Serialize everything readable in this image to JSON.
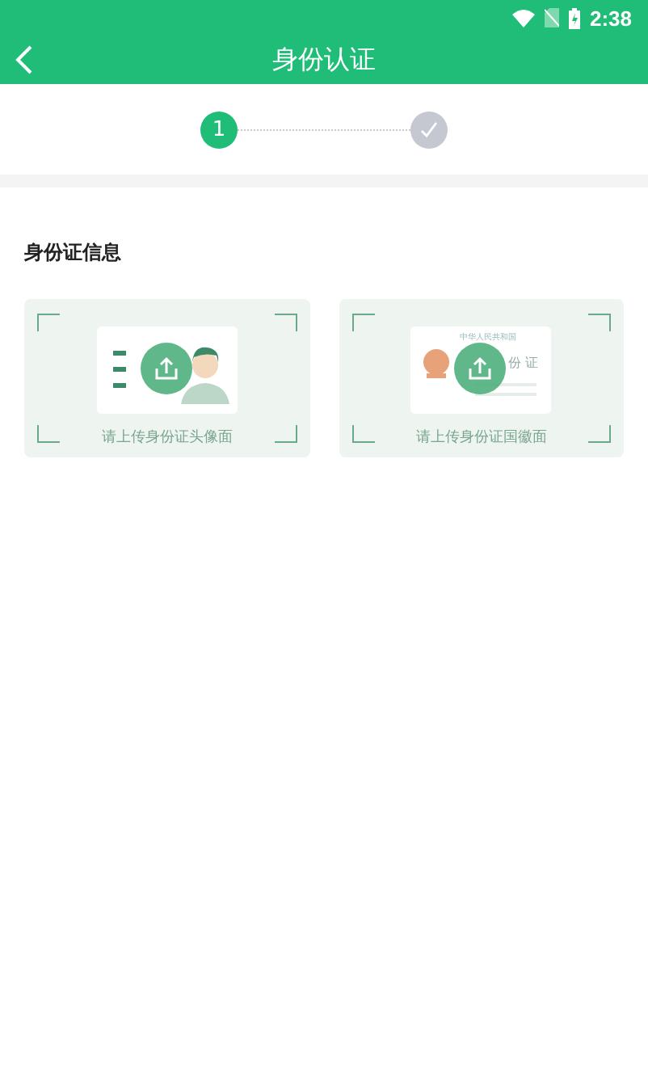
{
  "status_bar": {
    "time": "2:38"
  },
  "app_bar": {
    "title": "身份认证"
  },
  "steps": [
    {
      "kind": "number",
      "label": "1",
      "selected": true
    },
    {
      "kind": "check",
      "selected": false
    }
  ],
  "section": {
    "title": "身份证信息"
  },
  "upload_cards": [
    {
      "kind": "portrait",
      "caption": "请上传身份证头像面"
    },
    {
      "kind": "emblem",
      "caption": "请上传身份证国徽面",
      "card_heading": "中华人民共和国",
      "card_label": "份 证"
    }
  ]
}
